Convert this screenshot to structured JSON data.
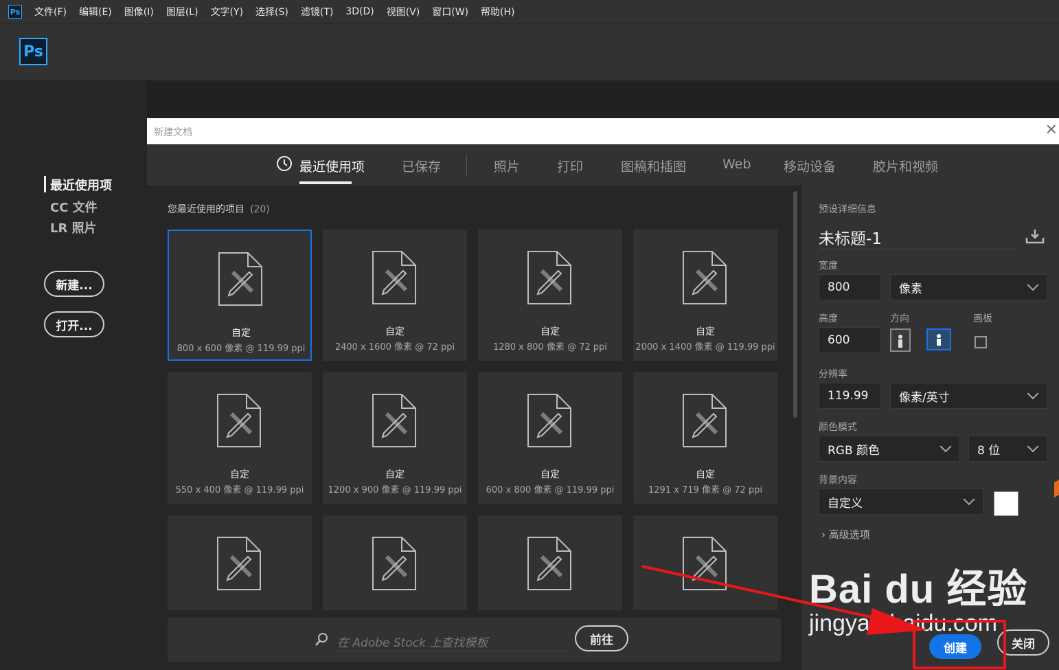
{
  "menubar": {
    "items": [
      "文件(F)",
      "编辑(E)",
      "图像(I)",
      "图层(L)",
      "文字(Y)",
      "选择(S)",
      "滤镜(T)",
      "3D(D)",
      "视图(V)",
      "窗口(W)",
      "帮助(H)"
    ]
  },
  "app": {
    "logo": "Ps"
  },
  "left_panel": {
    "items": [
      "最近使用项",
      "CC 文件",
      "LR 照片"
    ],
    "new_button": "新建...",
    "open_button": "打开..."
  },
  "dialog": {
    "title": "新建文档",
    "tabs": [
      "最近使用项",
      "已保存",
      "照片",
      "打印",
      "图稿和插图",
      "Web",
      "移动设备",
      "胶片和视频"
    ],
    "recent_label": "您最近使用的项目",
    "recent_count": "(20)",
    "cards": [
      {
        "name": "自定",
        "info": "800 x 600 像素 @ 119.99 ppi"
      },
      {
        "name": "自定",
        "info": "2400 x 1600 像素 @ 72 ppi"
      },
      {
        "name": "自定",
        "info": "1280 x 800 像素 @ 72 ppi"
      },
      {
        "name": "自定",
        "info": "2000 x 1400 像素 @ 119.99 ppi"
      },
      {
        "name": "自定",
        "info": "550 x 400 像素 @ 119.99 ppi"
      },
      {
        "name": "自定",
        "info": "1200 x 900 像素 @ 119.99 ppi"
      },
      {
        "name": "自定",
        "info": "600 x 800 像素 @ 119.99 ppi"
      },
      {
        "name": "自定",
        "info": "1291 x 719 像素 @ 72 ppi"
      },
      {
        "name": "",
        "info": ""
      },
      {
        "name": "",
        "info": ""
      },
      {
        "name": "",
        "info": ""
      },
      {
        "name": "",
        "info": ""
      }
    ],
    "stock_placeholder": "在 Adobe Stock 上查找模板",
    "go_button": "前往"
  },
  "preset": {
    "header": "预设详细信息",
    "doc_name": "未标题-1",
    "width_label": "宽度",
    "width_value": "800",
    "width_unit": "像素",
    "height_label": "高度",
    "height_value": "600",
    "orientation_label": "方向",
    "artboard_label": "画板",
    "resolution_label": "分辨率",
    "resolution_value": "119.99",
    "resolution_unit": "像素/英寸",
    "color_mode_label": "颜色模式",
    "color_mode": "RGB 颜色",
    "bit_depth": "8 位",
    "background_label": "背景内容",
    "background_value": "自定义",
    "background_color": "#ffffff",
    "advanced": "高级选项",
    "create_button": "创建",
    "close_button": "关闭"
  },
  "watermark": {
    "main": "Bai du 经验",
    "sub": "jingyan.baidu.com"
  },
  "colors": {
    "accent": "#1473e6",
    "ps_blue": "#31a8ff",
    "annotation_red": "#e8171c"
  }
}
